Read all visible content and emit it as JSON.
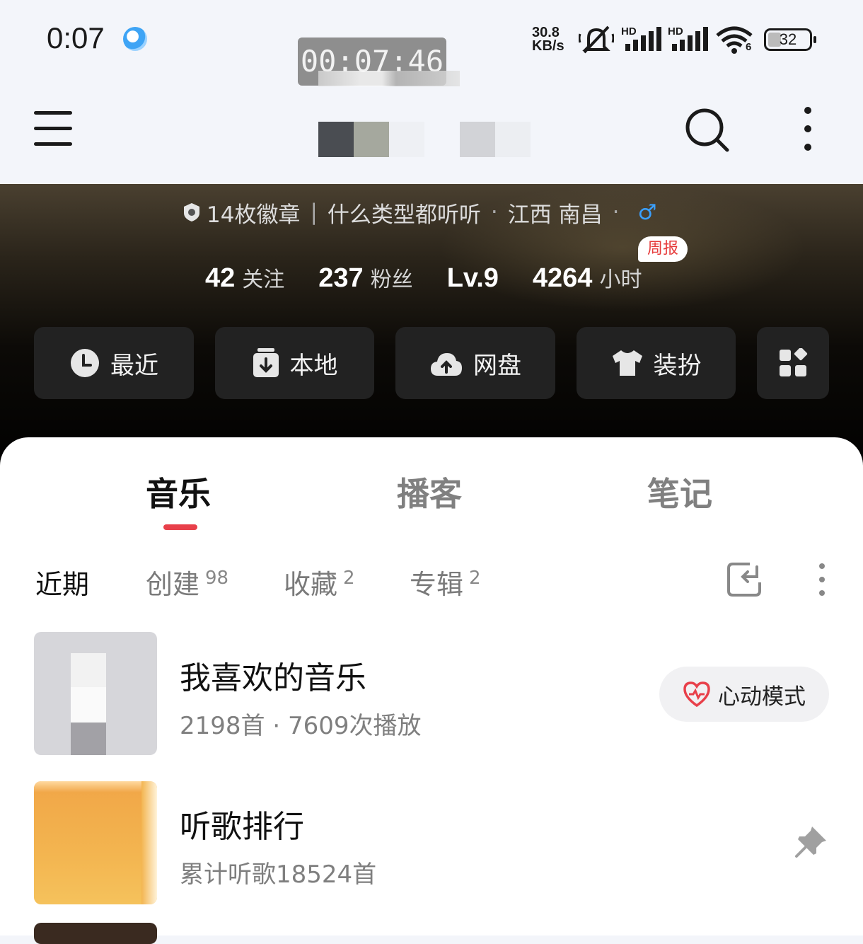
{
  "status_bar": {
    "time": "0:07",
    "recording_timer": "00:07:46",
    "net_speed_value": "30.8",
    "net_speed_unit": "KB/s",
    "signal_1_label": "HD",
    "signal_2_label": "HD",
    "wifi_label": "6",
    "battery": "32",
    "battery_level_percent": 32,
    "icons": [
      "app-notification-icon",
      "mute-icon",
      "signal-icon",
      "signal-icon",
      "wifi-icon",
      "battery-icon"
    ]
  },
  "app_bar": {
    "icons": [
      "menu-icon",
      "search-icon",
      "more-vertical-icon"
    ]
  },
  "profile": {
    "badges": "14枚徽章",
    "separator": "|",
    "tagline": "什么类型都听听",
    "dot1": "·",
    "location": "江西 南昌",
    "dot2": "·",
    "gender_symbol": "♂",
    "stats": [
      {
        "num": "42",
        "label": "关注"
      },
      {
        "num": "237",
        "label": "粉丝"
      },
      {
        "num": "Lv.9",
        "label": ""
      },
      {
        "num": "4264",
        "label": "小时"
      }
    ],
    "weekly_badge": "周报"
  },
  "quick_actions": [
    {
      "label": "最近",
      "icon": "clock-icon"
    },
    {
      "label": "本地",
      "icon": "download-icon"
    },
    {
      "label": "网盘",
      "icon": "cloud-upload-icon"
    },
    {
      "label": "装扮",
      "icon": "shirt-icon"
    },
    {
      "label": "",
      "icon": "apps-grid-icon"
    }
  ],
  "tabs": [
    {
      "label": "音乐",
      "active": true
    },
    {
      "label": "播客",
      "active": false
    },
    {
      "label": "笔记",
      "active": false
    }
  ],
  "subtabs": [
    {
      "label": "近期",
      "count": ""
    },
    {
      "label": "创建",
      "count": "98"
    },
    {
      "label": "收藏",
      "count": "2"
    },
    {
      "label": "专辑",
      "count": "2"
    }
  ],
  "playlists": [
    {
      "title": "我喜欢的音乐",
      "subtitle": "2198首 · 7609次播放",
      "action": "心动模式"
    },
    {
      "title": "听歌排行",
      "subtitle": "累计听歌18524首",
      "action": ""
    }
  ],
  "colors": {
    "accent": "#e8404a",
    "background": "#f3f5fa",
    "hero_dark": "#000000",
    "quick_btn": "#222222"
  }
}
